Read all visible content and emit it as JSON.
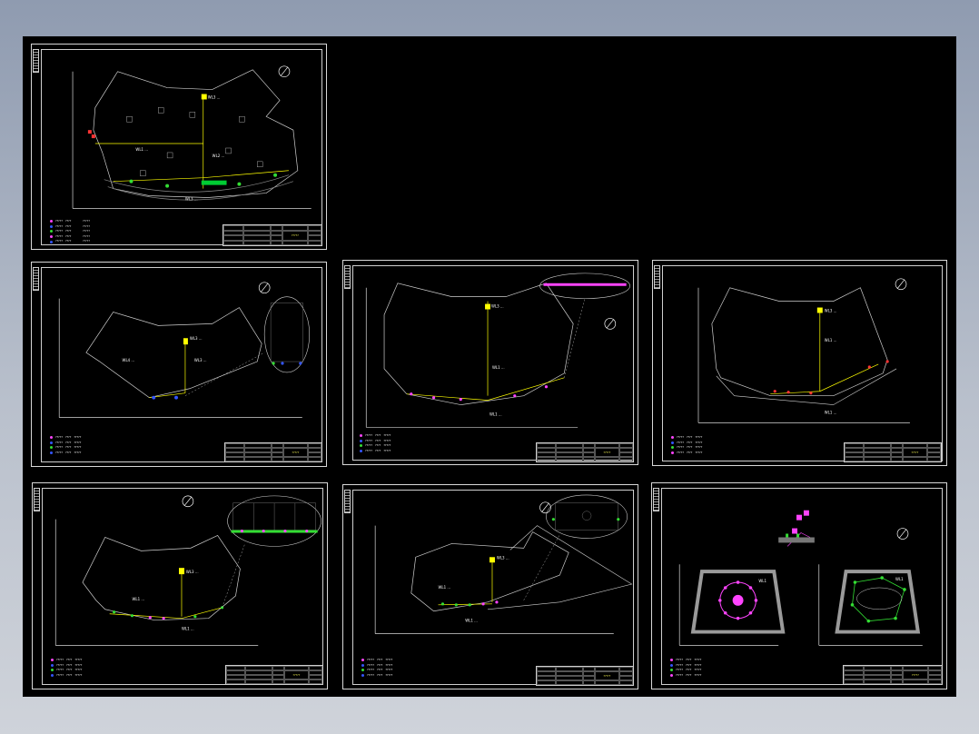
{
  "colors": {
    "background_gradient_top": "#8f9bb0",
    "background_gradient_bottom": "#cfd3da",
    "canvas": "#000000",
    "frame": "#d8d8d8",
    "route_yellow": "#ffff00",
    "fixture_green": "#33dd33",
    "fixture_magenta": "#ff44ff",
    "fixture_blue": "#3355ff",
    "fixture_red": "#ff3333"
  },
  "sheets": [
    {
      "name": "sheet-1",
      "circuit_labels": [
        "WL3 ...",
        "WL1 ...",
        "WL2 ..."
      ],
      "title": "?????"
    },
    {
      "name": "sheet-2",
      "circuit_labels": [
        "WL3 ...",
        "WL4 ..."
      ],
      "title": "?????"
    },
    {
      "name": "sheet-3",
      "circuit_labels": [
        "WL3 ...",
        "WL1 ..."
      ],
      "title": "?????"
    },
    {
      "name": "sheet-4",
      "circuit_labels": [
        "WL3 ...",
        "WL1 ..."
      ],
      "title": "?????"
    },
    {
      "name": "sheet-5",
      "circuit_labels": [
        "WL3 ...",
        "WL1 ..."
      ],
      "title": "?????"
    },
    {
      "name": "sheet-6",
      "circuit_labels": [
        "WL3 ...",
        "WL1 ..."
      ],
      "title": "?????"
    },
    {
      "name": "sheet-7",
      "circuit_labels": [
        "WL1",
        "WL1"
      ],
      "title": "?????"
    }
  ],
  "legend_rows": [
    {
      "marker_color": "#ff44ff",
      "col1": "?????",
      "col2": "????",
      "col3": "?????"
    },
    {
      "marker_color": "#3355ff",
      "col1": "?????",
      "col2": "????",
      "col3": "?????"
    },
    {
      "marker_color": "#33dd33",
      "col1": "?????",
      "col2": "????",
      "col3": "?????"
    },
    {
      "marker_color": "#ff44ff",
      "col1": "?????",
      "col2": "????",
      "col3": "?????"
    },
    {
      "marker_color": "#3355ff",
      "col1": "?????",
      "col2": "????",
      "col3": "?????"
    }
  ],
  "icons": {
    "north_arrow": "north-arrow-icon"
  }
}
